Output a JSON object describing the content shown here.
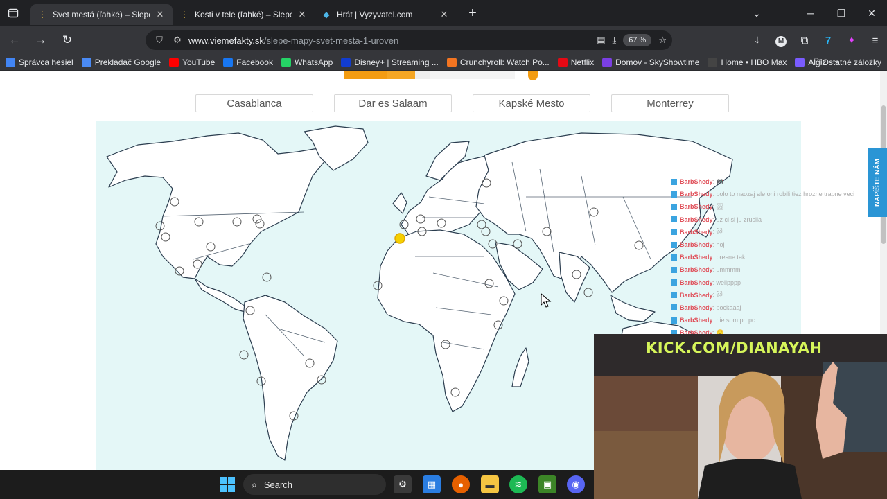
{
  "browser": {
    "tabs": [
      {
        "title": "Svet mestá (ľahké) – Slepé mapy",
        "active": true,
        "icon": "site-pin-icon"
      },
      {
        "title": "Kosti v tele (ľahké) – Slepé mapy",
        "active": false,
        "icon": "site-pin-icon"
      },
      {
        "title": "Hrát | Vyzyvatel.com",
        "active": false,
        "icon": "vyzyvatel-icon"
      }
    ],
    "url_host": "www.viemefakty.sk",
    "url_path": "/slepe-mapy-svet-mesta-1-uroven",
    "zoom": "67 %",
    "bookmarks": [
      {
        "label": "Správca hesiel",
        "icon": "google-icon",
        "color": "#4285f4"
      },
      {
        "label": "Prekladač Google",
        "icon": "translate-icon",
        "color": "#4a8af4"
      },
      {
        "label": "YouTube",
        "icon": "youtube-icon",
        "color": "#ff0000"
      },
      {
        "label": "Facebook",
        "icon": "facebook-icon",
        "color": "#1877f2"
      },
      {
        "label": "WhatsApp",
        "icon": "whatsapp-icon",
        "color": "#25d366"
      },
      {
        "label": "Disney+ | Streaming ...",
        "icon": "disney-icon",
        "color": "#113ccf"
      },
      {
        "label": "Crunchyroll: Watch Po...",
        "icon": "crunchyroll-icon",
        "color": "#f47521"
      },
      {
        "label": "Netflix",
        "icon": "netflix-icon",
        "color": "#e50914"
      },
      {
        "label": "Domov - SkyShowtime",
        "icon": "skyshowtime-icon",
        "color": "#7b3fe4"
      },
      {
        "label": "Home • HBO Max",
        "icon": "hbo-icon",
        "color": "#444444"
      },
      {
        "label": "Algiz",
        "icon": "algiz-icon",
        "color": "#7a5cff"
      }
    ],
    "other_bookmarks": "Ostatné záložky"
  },
  "quiz": {
    "choices": [
      "Casablanca",
      "Dar es Salaam",
      "Kapské Mesto",
      "Monterrey"
    ],
    "write_us": "NAPÍŠTE NÁM"
  },
  "chat": [
    {
      "user": "BarbShedy",
      "msg": ": 🎮"
    },
    {
      "user": "BarbShedy",
      "msg": ": bolo to naozaj ale oni robili tiez hrozne trapne veci"
    },
    {
      "user": "BarbShedy",
      "msg": ": 🏞"
    },
    {
      "user": "BarbShedy",
      "msg": ": uz ci si ju zrusila"
    },
    {
      "user": "BarbShedy",
      "msg": ": 🐱"
    },
    {
      "user": "BarbShedy",
      "msg": ": hoj"
    },
    {
      "user": "BarbShedy",
      "msg": ": presne tak"
    },
    {
      "user": "BarbShedy",
      "msg": ": ummmm"
    },
    {
      "user": "BarbShedy",
      "msg": ": wellpppp"
    },
    {
      "user": "BarbShedy",
      "msg": ": 🐱"
    },
    {
      "user": "BarbShedy",
      "msg": ": pockaaaj"
    },
    {
      "user": "BarbShedy",
      "msg": ": nie som pri pc"
    },
    {
      "user": "BarbShedy",
      "msg": ": 🙂"
    }
  ],
  "stream": {
    "overlay_text": "KICK.COM/DIANAYAH"
  },
  "taskbar": {
    "search_placeholder": "Search"
  }
}
